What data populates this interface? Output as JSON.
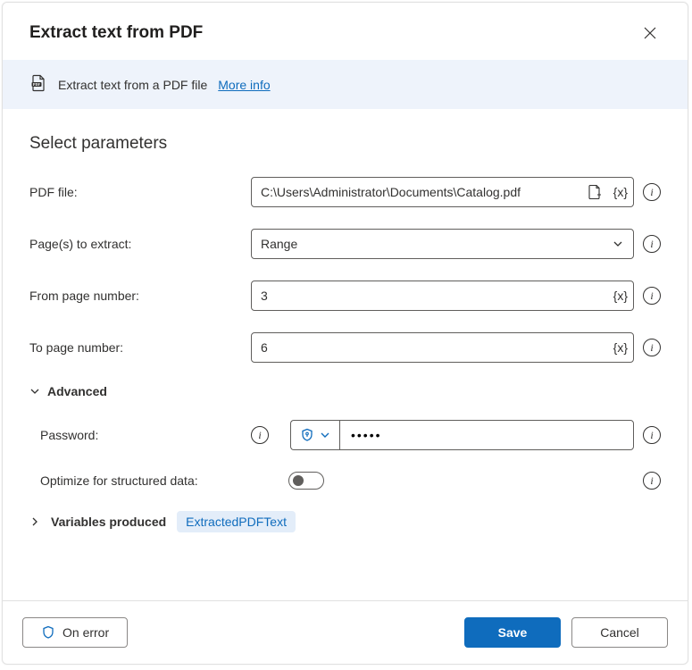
{
  "header": {
    "title": "Extract text from PDF"
  },
  "banner": {
    "text": "Extract text from a PDF file",
    "more": "More info"
  },
  "section": {
    "title": "Select parameters"
  },
  "fields": {
    "pdf_label": "PDF file:",
    "pdf_value": "C:\\Users\\Administrator\\Documents\\Catalog.pdf",
    "pages_label": "Page(s) to extract:",
    "pages_value": "Range",
    "from_label": "From page number:",
    "from_value": "3",
    "to_label": "To page number:",
    "to_value": "6"
  },
  "advanced": {
    "header": "Advanced",
    "password_label": "Password:",
    "password_value": "•••••",
    "optimize_label": "Optimize for structured data:"
  },
  "variables": {
    "header": "Variables produced",
    "pill": "ExtractedPDFText"
  },
  "footer": {
    "on_error": "On error",
    "save": "Save",
    "cancel": "Cancel"
  },
  "glyphs": {
    "var": "{x}"
  }
}
